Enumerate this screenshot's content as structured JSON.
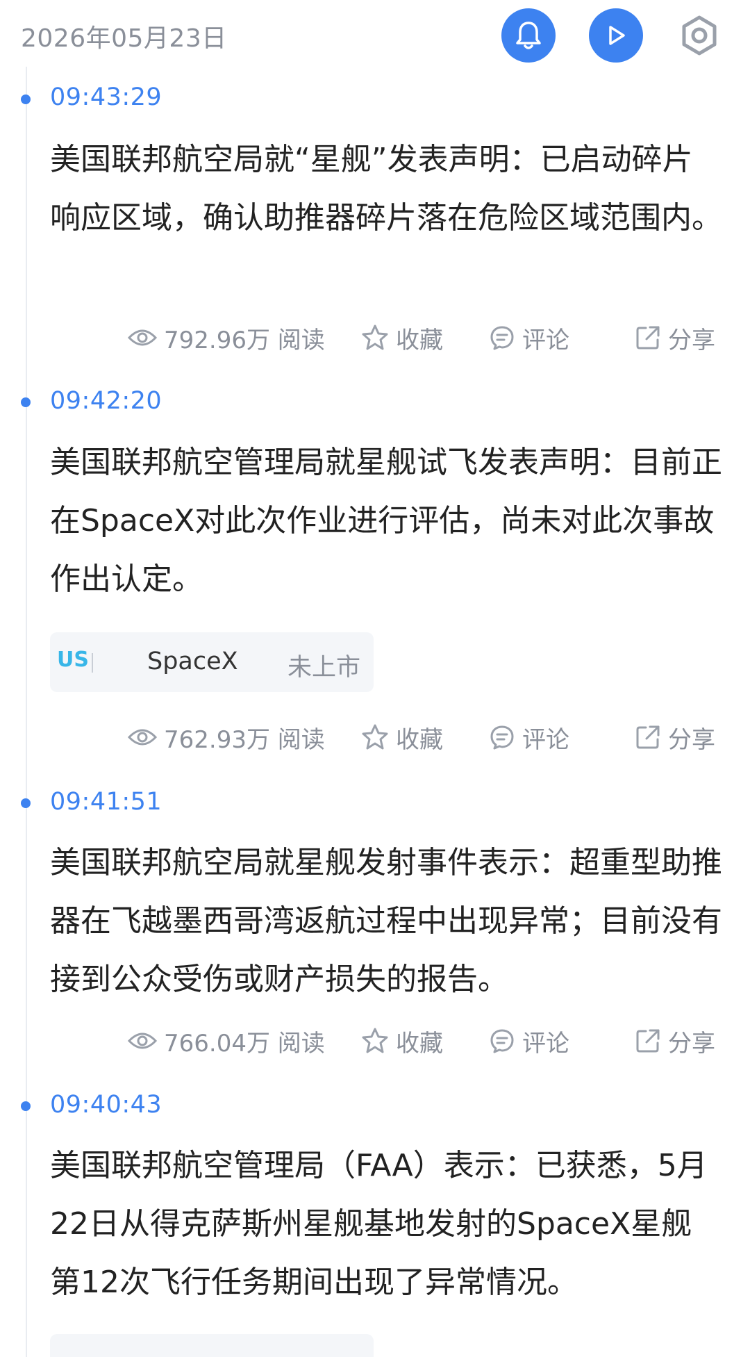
{
  "header": {
    "date": "2026年05月23日",
    "buttons": [
      {
        "icon": "bell-icon"
      },
      {
        "icon": "play-icon"
      },
      {
        "icon": "gear-icon"
      }
    ]
  },
  "colors": {
    "accent": "#3d82f0",
    "muted": "#8a8f99",
    "us_badge": "#38b6e8"
  },
  "news": [
    {
      "time": "09:43:29",
      "text": "美国联邦航空局就“星舰”发表声明：已启动碎片响应区域，确认助推器碎片落在危险区域范围内。",
      "reads": "792.96万 阅读",
      "fav": "收藏",
      "comment": "评论",
      "share": "分享"
    },
    {
      "time": "09:42:20",
      "text": "美国联邦航空管理局就星舰试飞发表声明：目前正在SpaceX对此次作业进行评估，尚未对此次事故作出认定。",
      "tag": {
        "market": "US",
        "name": "SpaceX",
        "status": "未上市"
      },
      "reads": "762.93万 阅读",
      "fav": "收藏",
      "comment": "评论",
      "share": "分享"
    },
    {
      "time": "09:41:51",
      "text": "美国联邦航空局就星舰发射事件表示：超重型助推器在飞越墨西哥湾返航过程中出现异常；目前没有接到公众受伤或财产损失的报告。",
      "reads": "766.04万 阅读",
      "fav": "收藏",
      "comment": "评论",
      "share": "分享"
    },
    {
      "time": "09:40:43",
      "text": "美国联邦航空管理局（FAA）表示：已获悉，5月22日从得克萨斯州星舰基地发射的SpaceX星舰第12次飞行任务期间出现了异常情况。"
    }
  ]
}
